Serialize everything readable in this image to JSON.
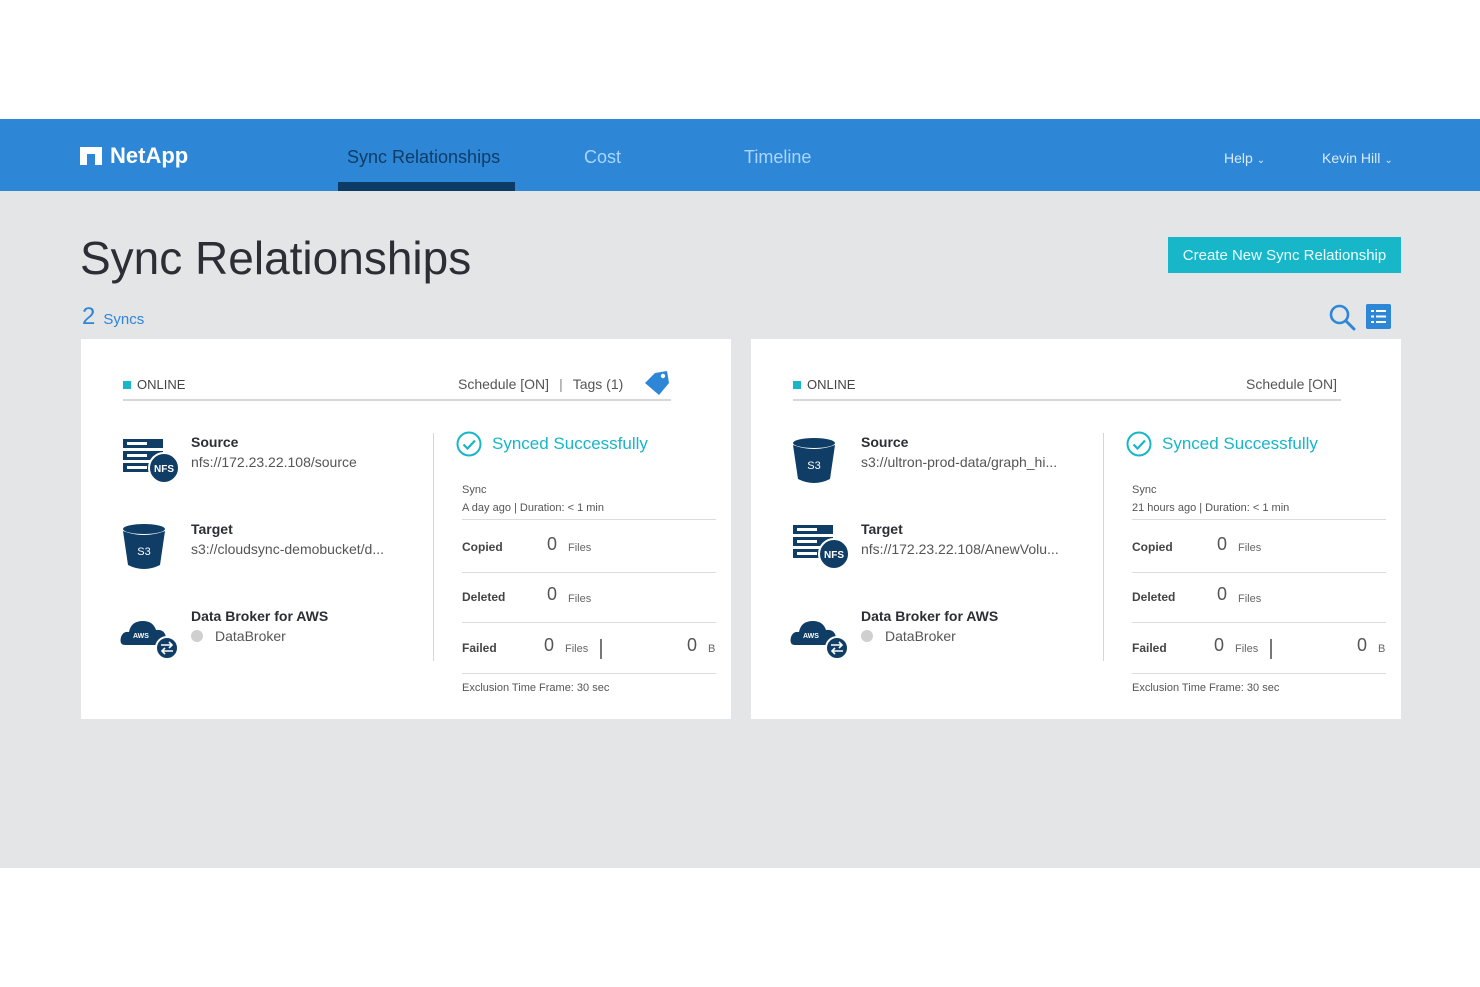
{
  "header": {
    "brand": "NetApp",
    "tabs": [
      {
        "label": "Sync Relationships",
        "active": true
      },
      {
        "label": "Cost",
        "active": false
      },
      {
        "label": "Timeline",
        "active": false
      }
    ],
    "help": "Help",
    "user": "Kevin Hill"
  },
  "page": {
    "title": "Sync Relationships",
    "sync_count": "2",
    "sync_count_label": "Syncs",
    "create_button": "Create New Sync Relationship"
  },
  "cards": [
    {
      "status": "ONLINE",
      "schedule": "Schedule [ON]",
      "tags": "Tags (1)",
      "source": {
        "title": "Source",
        "path": "nfs://172.23.22.108/source",
        "icon": "nfs-server-icon"
      },
      "target": {
        "title": "Target",
        "path": "s3://cloudsync-demobucket/d...",
        "icon": "s3-bucket-icon"
      },
      "broker": {
        "title": "Data Broker for AWS",
        "name": "DataBroker",
        "icon": "aws-cloud-icon"
      },
      "result": "Synced Successfully",
      "sync_label": "Sync",
      "sync_info": "A day ago  |  Duration: < 1 min",
      "copied": {
        "label": "Copied",
        "value": "0",
        "unit": "Files"
      },
      "deleted": {
        "label": "Deleted",
        "value": "0",
        "unit": "Files"
      },
      "failed": {
        "label": "Failed",
        "value": "0",
        "unit": "Files",
        "bytes": "0",
        "bytes_unit": "B"
      },
      "exclusion": "Exclusion Time Frame: 30 sec"
    },
    {
      "status": "ONLINE",
      "schedule": "Schedule [ON]",
      "source": {
        "title": "Source",
        "path": "s3://ultron-prod-data/graph_hi...",
        "icon": "s3-bucket-icon"
      },
      "target": {
        "title": "Target",
        "path": "nfs://172.23.22.108/AnewVolu...",
        "icon": "nfs-server-icon"
      },
      "broker": {
        "title": "Data Broker for AWS",
        "name": "DataBroker",
        "icon": "aws-cloud-icon"
      },
      "result": "Synced Successfully",
      "sync_label": "Sync",
      "sync_info": "21 hours ago  |  Duration: < 1 min",
      "copied": {
        "label": "Copied",
        "value": "0",
        "unit": "Files"
      },
      "deleted": {
        "label": "Deleted",
        "value": "0",
        "unit": "Files"
      },
      "failed": {
        "label": "Failed",
        "value": "0",
        "unit": "Files",
        "bytes": "0",
        "bytes_unit": "B"
      },
      "exclusion": "Exclusion Time Frame: 30 sec"
    }
  ],
  "colors": {
    "nav": "#2e86d6",
    "accent": "#17b6c8",
    "nav_active": "#0c3b66"
  }
}
